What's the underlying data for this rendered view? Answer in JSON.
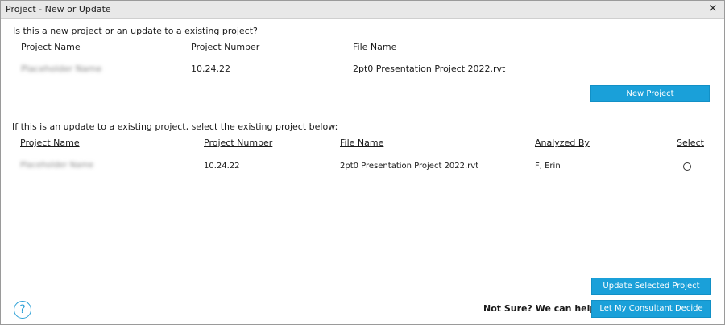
{
  "window": {
    "title": "Project - New or Update",
    "close_glyph": "×"
  },
  "new_section": {
    "question": "Is this a new project or an update to a existing project?",
    "headers": {
      "project_name": "Project Name",
      "project_number": "Project Number",
      "file_name": "File Name"
    },
    "row": {
      "project_name": "Placeholder Name",
      "project_number": "10.24.22",
      "file_name": "2pt0 Presentation Project 2022.rvt"
    },
    "new_project_button": "New Project"
  },
  "update_section": {
    "question": "If this is an update to a existing project, select the existing project below:",
    "headers": {
      "project_name": "Project Name",
      "project_number": "Project Number",
      "file_name": "File Name",
      "analyzed_by": "Analyzed By",
      "select": "Select"
    },
    "rows": [
      {
        "project_name": "Placeholder Name",
        "project_number": "10.24.22",
        "file_name": "2pt0 Presentation Project 2022.rvt",
        "analyzed_by": "F, Erin",
        "selected": false
      }
    ]
  },
  "footer": {
    "help_glyph": "?",
    "help_text": "Not Sure? We can help:",
    "update_button": "Update Selected Project",
    "consultant_button": "Let My Consultant Decide"
  },
  "colors": {
    "accent": "#1aa0d9",
    "titlebar": "#e8e8e8"
  }
}
